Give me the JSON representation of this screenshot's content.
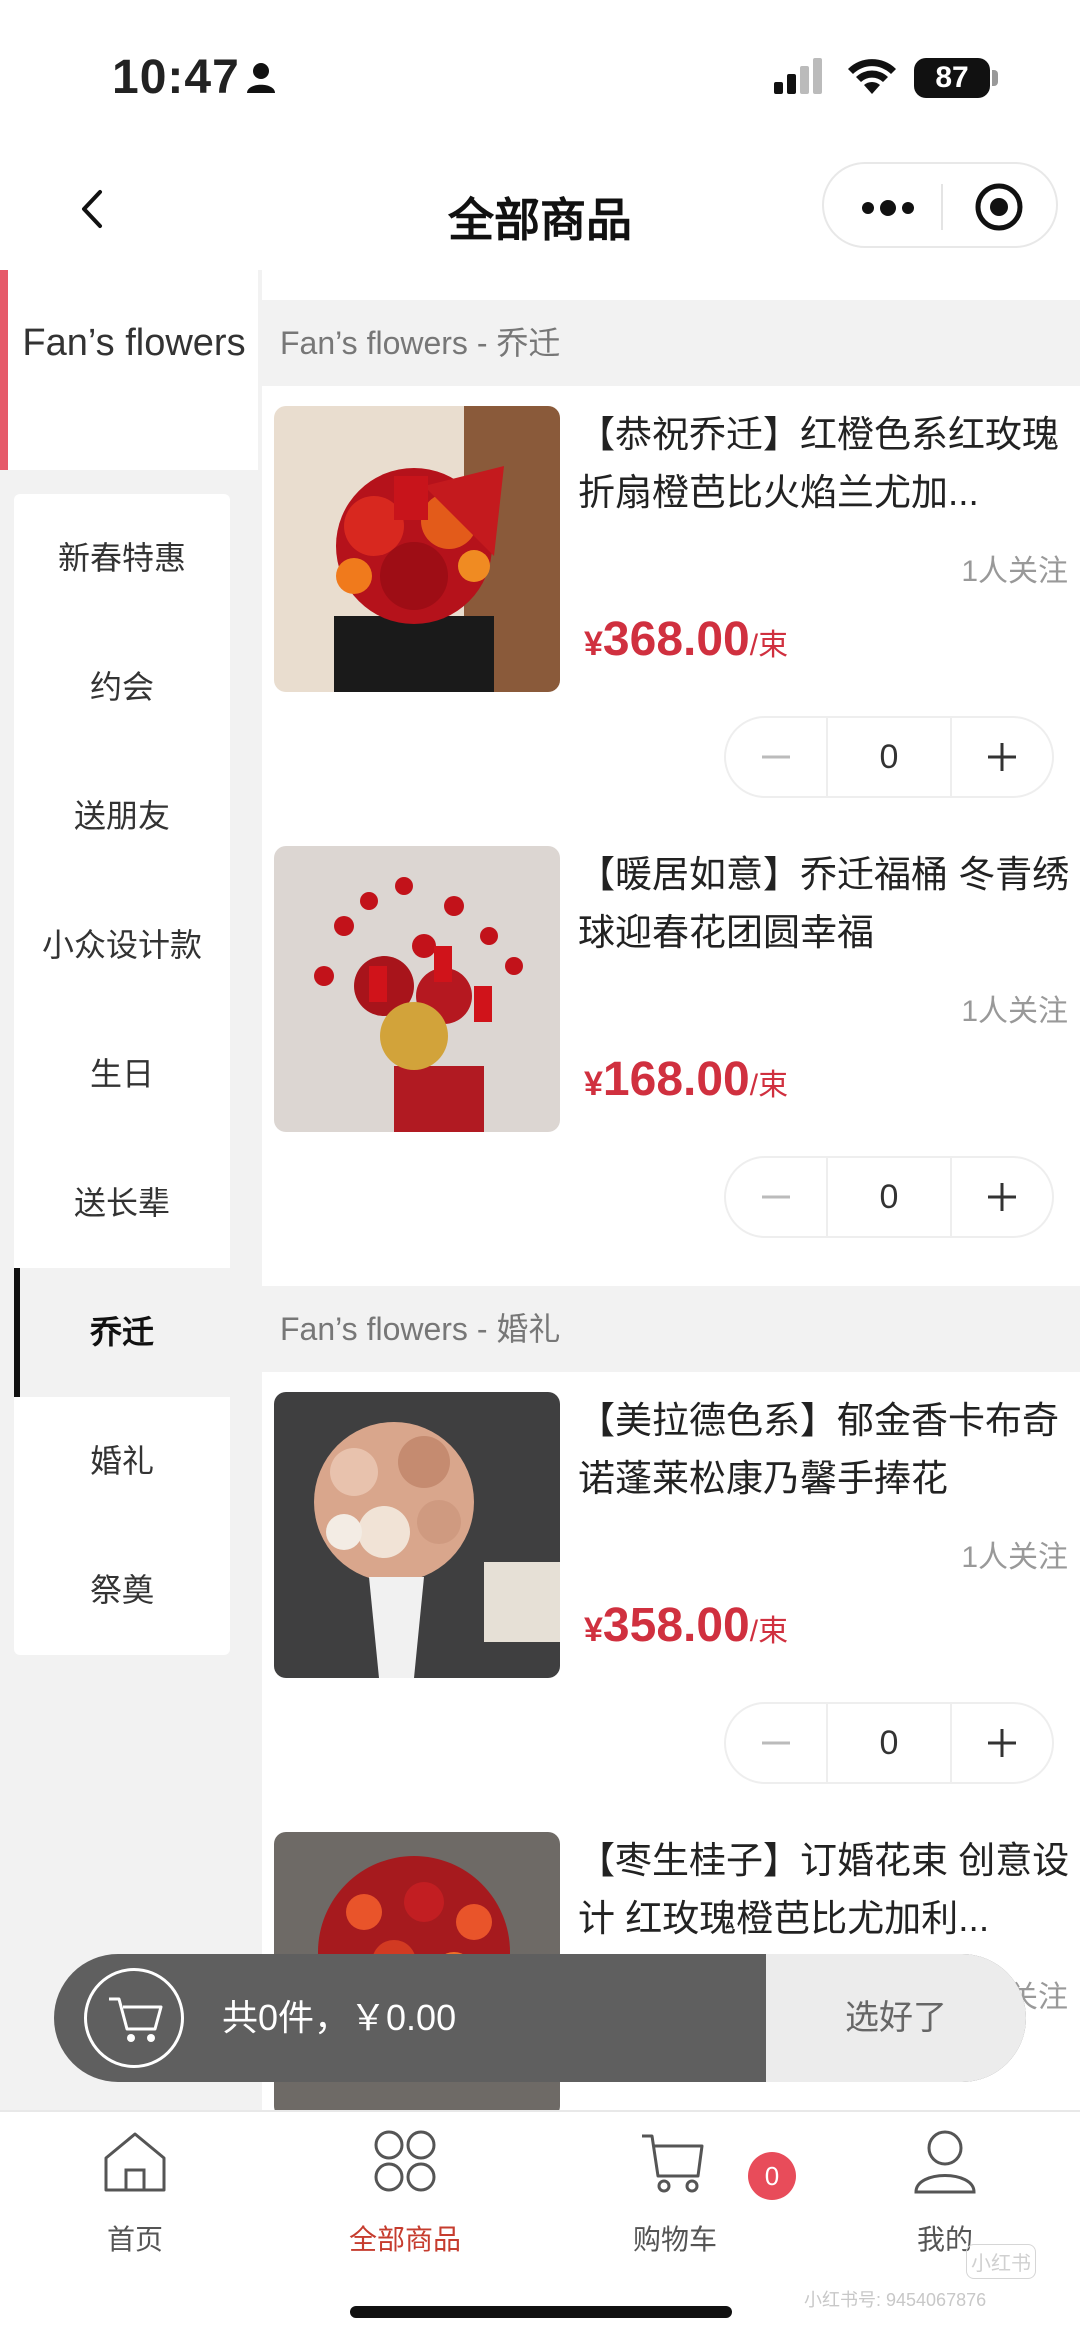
{
  "status_bar": {
    "time": "10:47",
    "battery": "87"
  },
  "navbar": {
    "title": "全部商品"
  },
  "sidebar": {
    "store": "Fan’s flowers",
    "categories": [
      "新春特惠",
      "约会",
      "送朋友",
      "小众设计款",
      "生日",
      "送长辈",
      "乔迁",
      "婚礼",
      "祭奠"
    ],
    "active_category": "乔迁"
  },
  "sections": [
    {
      "title": "Fan’s flowers - 乔迁"
    },
    {
      "title": "Fan’s flowers - 婚礼"
    }
  ],
  "products": [
    {
      "name": "【恭祝乔迁】红橙色系红玫瑰折扇橙芭比火焰兰尤加...",
      "followers": "1人关注",
      "currency": "¥",
      "price": "368.00",
      "unit": "/束",
      "quantity": "0"
    },
    {
      "name": "【暖居如意】乔迁福桶 冬青绣球迎春花团圆幸福",
      "followers": "1人关注",
      "currency": "¥",
      "price": "168.00",
      "unit": "/束",
      "quantity": "0"
    },
    {
      "name": "【美拉德色系】郁金香卡布奇诺蓬莱松康乃馨手捧花",
      "followers": "1人关注",
      "currency": "¥",
      "price": "358.00",
      "unit": "/束",
      "quantity": "0"
    },
    {
      "name": "【枣生桂子】订婚花束 创意设计 红玫瑰橙芭比尤加利...",
      "followers": "1人关注",
      "currency": "¥",
      "price": "",
      "unit": "/束",
      "quantity": ""
    }
  ],
  "cart_bar": {
    "summary": "共0件，￥0.00",
    "confirm": "选好了"
  },
  "tabbar": {
    "items": [
      {
        "label": "首页",
        "icon": "home-icon"
      },
      {
        "label": "全部商品",
        "icon": "grid-icon"
      },
      {
        "label": "购物车",
        "icon": "cart-icon"
      },
      {
        "label": "我的",
        "icon": "user-icon"
      }
    ],
    "active": "全部商品",
    "cart_badge": "0"
  },
  "watermark": {
    "text": "小红书号: 9454067876",
    "logo": "小红书"
  },
  "colors": {
    "price": "#d0303f",
    "accent": "#c63c2e",
    "store_bar": "#e65a6a",
    "badge": "#e84c5a"
  }
}
